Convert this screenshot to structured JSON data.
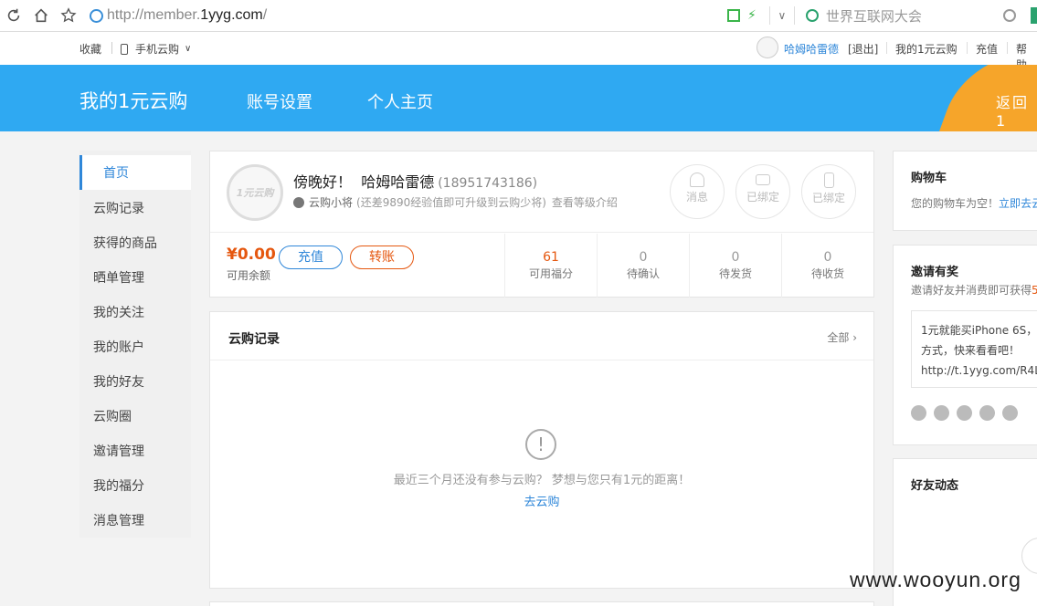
{
  "browser": {
    "url_prefix": "http://member.",
    "url_domain": "1yyg.com",
    "url_suffix": "/",
    "search_text": "世界互联网大会"
  },
  "topnav": {
    "favorites": "收藏",
    "mobile": "手机云购",
    "username": "哈姆哈雷德",
    "logout": "[退出]",
    "my_account": "我的1元云购",
    "recharge": "充值",
    "help": "帮助"
  },
  "header": {
    "title": "我的1元云购",
    "account_settings": "账号设置",
    "homepage": "个人主页",
    "back": "返回1"
  },
  "sidebar": {
    "items": [
      {
        "label": "首页"
      },
      {
        "label": "云购记录"
      },
      {
        "label": "获得的商品"
      },
      {
        "label": "晒单管理"
      },
      {
        "label": "我的关注"
      },
      {
        "label": "我的账户"
      },
      {
        "label": "我的好友"
      },
      {
        "label": "云购圈"
      },
      {
        "label": "邀请管理"
      },
      {
        "label": "我的福分"
      },
      {
        "label": "消息管理"
      }
    ]
  },
  "user": {
    "avatar_text": "1元云购",
    "greeting": "傍晚好！",
    "name": "哈姆哈雷德",
    "phone": "(18951743186)",
    "level": "云购小将",
    "level_note": "(还差9890经验值即可升级到云购少将)",
    "level_link": "查看等级介绍",
    "icons": [
      {
        "label": "消息"
      },
      {
        "label": "已绑定"
      },
      {
        "label": "已绑定"
      }
    ],
    "balance": "¥0.00",
    "balance_label": "可用余额",
    "recharge_btn": "充值",
    "transfer_btn": "转账",
    "stats": [
      {
        "value": "61",
        "label": "可用福分"
      },
      {
        "value": "0",
        "label": "待确认"
      },
      {
        "value": "0",
        "label": "待发货"
      },
      {
        "value": "0",
        "label": "待收货"
      }
    ]
  },
  "records": {
    "title": "云购记录",
    "all": "全部",
    "empty_text": "最近三个月还没有参与云购？ 梦想与您只有1元的距离！",
    "go_link": "去云购"
  },
  "cart": {
    "title": "购物车",
    "empty": "您的购物车为空！",
    "link": "立即去云"
  },
  "invite": {
    "title": "邀请有奖",
    "subtitle": "邀请好友并消费即可获得",
    "subtitle_highlight": "5",
    "lines": [
      "1元就能买iPhone 6S，",
      "方式，快来看看吧！",
      "http://t.1yyg.com/R4L"
    ]
  },
  "friends": {
    "title": "好友动态"
  },
  "watermark": "www.wooyun.org",
  "colors": {
    "brand_blue": "#2fa9f2",
    "link_blue": "#2f87d9",
    "accent_orange": "#e5570f",
    "back_orange": "#f6a52a"
  }
}
